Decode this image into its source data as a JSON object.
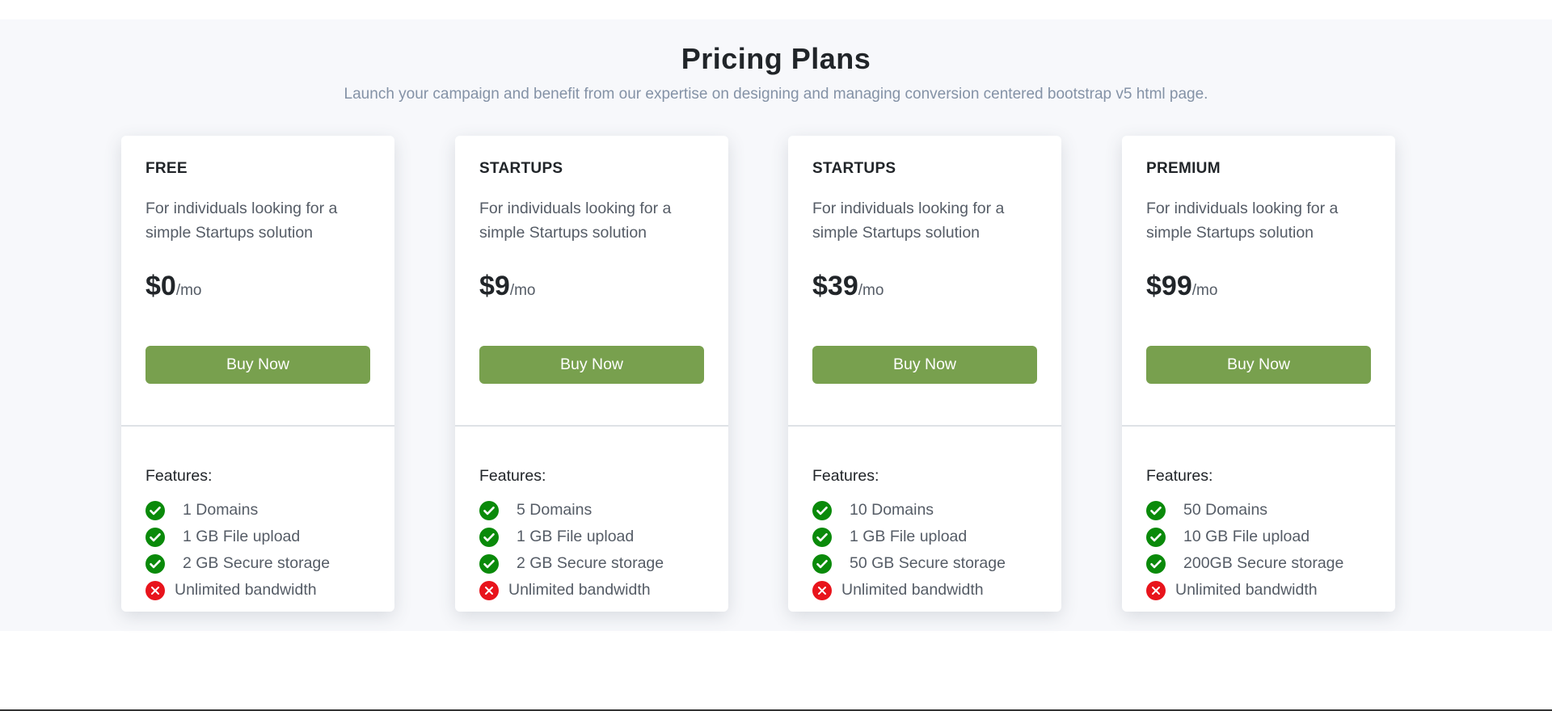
{
  "header": {
    "title": "Pricing Plans",
    "subtitle": "Launch your campaign and benefit from our expertise on designing and managing conversion centered bootstrap v5 html page."
  },
  "colors": {
    "button": "#78a04e",
    "check": "#0a8a0a",
    "cross": "#e8141c",
    "section_bg": "#f7f8fb"
  },
  "plans": [
    {
      "name": "FREE",
      "description": "For individuals looking for a simple Startups solution",
      "price": "$0",
      "period": "/mo",
      "button_label": "Buy Now",
      "features_label": "Features:",
      "features": [
        {
          "text": "1 Domains",
          "included": true,
          "icon": "check-circle-icon"
        },
        {
          "text": "1 GB File upload",
          "included": true,
          "icon": "check-circle-icon"
        },
        {
          "text": "2 GB Secure storage",
          "included": true,
          "icon": "check-circle-icon"
        },
        {
          "text": "Unlimited bandwidth",
          "included": false,
          "icon": "x-circle-icon"
        }
      ]
    },
    {
      "name": "STARTUPS",
      "description": "For individuals looking for a simple Startups solution",
      "price": "$9",
      "period": "/mo",
      "button_label": "Buy Now",
      "features_label": "Features:",
      "features": [
        {
          "text": "5 Domains",
          "included": true,
          "icon": "check-circle-icon"
        },
        {
          "text": "1 GB File upload",
          "included": true,
          "icon": "check-circle-icon"
        },
        {
          "text": "2 GB Secure storage",
          "included": true,
          "icon": "check-circle-icon"
        },
        {
          "text": "Unlimited bandwidth",
          "included": false,
          "icon": "x-circle-icon"
        }
      ]
    },
    {
      "name": "STARTUPS",
      "description": "For individuals looking for a simple Startups solution",
      "price": "$39",
      "period": "/mo",
      "button_label": "Buy Now",
      "features_label": "Features:",
      "features": [
        {
          "text": "10 Domains",
          "included": true,
          "icon": "check-circle-icon"
        },
        {
          "text": "1 GB File upload",
          "included": true,
          "icon": "check-circle-icon"
        },
        {
          "text": "50 GB Secure storage",
          "included": true,
          "icon": "check-circle-icon"
        },
        {
          "text": "Unlimited bandwidth",
          "included": false,
          "icon": "x-circle-icon"
        }
      ]
    },
    {
      "name": "PREMIUM",
      "description": "For individuals looking for a simple Startups solution",
      "price": "$99",
      "period": "/mo",
      "button_label": "Buy Now",
      "features_label": "Features:",
      "features": [
        {
          "text": "50 Domains",
          "included": true,
          "icon": "check-circle-icon"
        },
        {
          "text": "10 GB File upload",
          "included": true,
          "icon": "check-circle-icon"
        },
        {
          "text": "200GB Secure storage",
          "included": true,
          "icon": "check-circle-icon"
        },
        {
          "text": "Unlimited bandwidth",
          "included": false,
          "icon": "x-circle-icon"
        }
      ]
    }
  ]
}
